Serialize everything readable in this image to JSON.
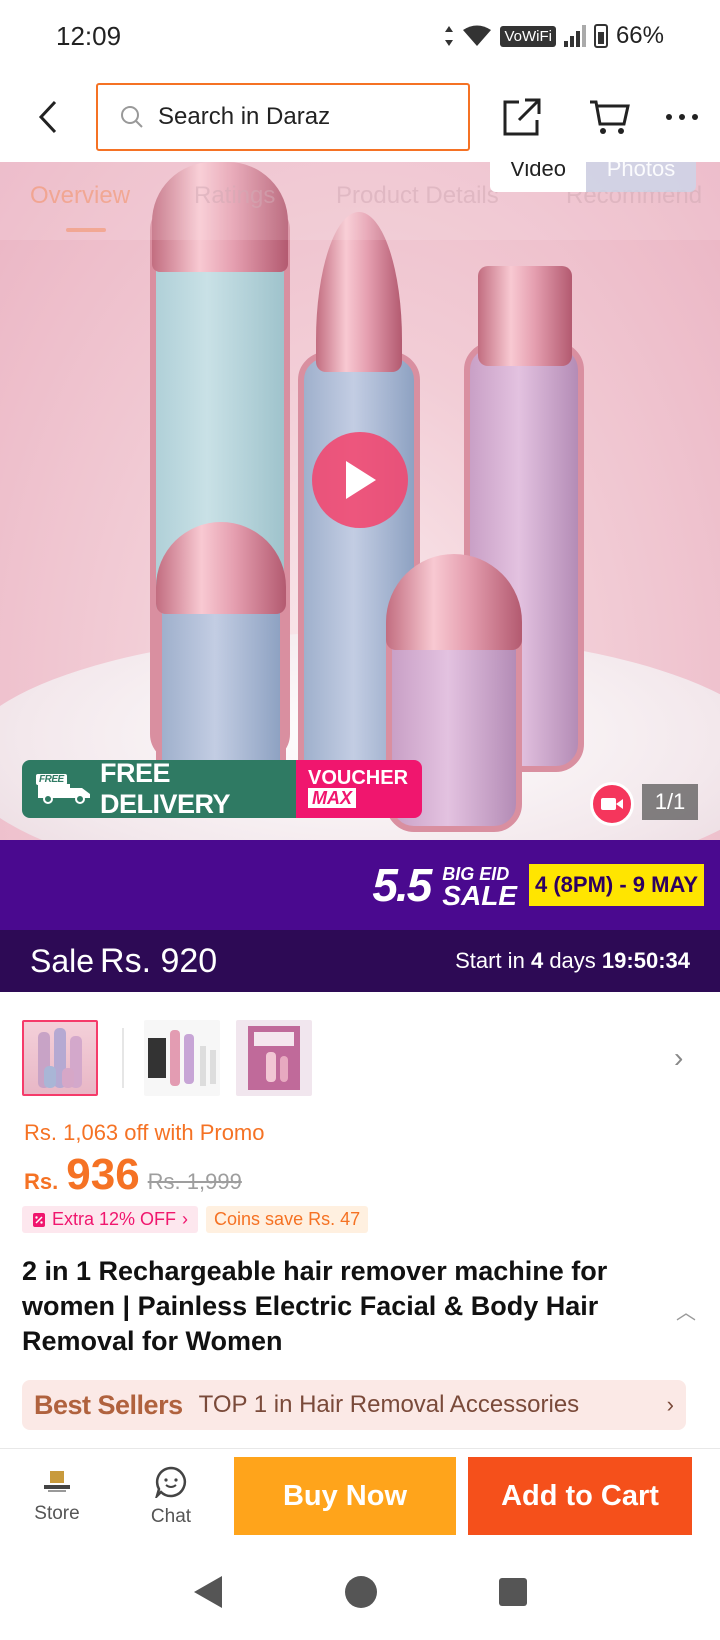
{
  "status": {
    "time": "12:09",
    "vowifi": "VoWiFi",
    "battery": "66%"
  },
  "header": {
    "search_placeholder": "Search in Daraz"
  },
  "hero": {
    "tabs": [
      "Overview",
      "Ratings",
      "Product Details",
      "Recommend"
    ],
    "media_video": "Video",
    "media_photos": "Photos",
    "counter": "1/1",
    "promo": {
      "free_tag": "FREE",
      "free_delivery": "FREE DELIVERY",
      "voucher": "VOUCHER",
      "voucher_max": "MAX"
    }
  },
  "sale_banner": {
    "number": "5.5",
    "big": "BIG EID",
    "sale": "SALE",
    "dates": "4 (8PM) - 9 MAY"
  },
  "sale_price": {
    "label": "Sale",
    "price": "Rs. 920",
    "start_in": "Start in",
    "days": "4",
    "days_label": "days",
    "countdown": "19:50:34"
  },
  "price": {
    "promo_off": "Rs. 1,063 off with Promo",
    "currency": "Rs.",
    "current": "936",
    "original": "Rs. 1,999",
    "extra_off": "Extra 12% OFF",
    "coins": "Coins save Rs. 47"
  },
  "product": {
    "title": "2 in 1 Rechargeable hair remover machine for women | Painless Electric Facial & Body Hair Removal for Women"
  },
  "bestseller": {
    "logo": "Best Sellers",
    "text": "TOP 1 in Hair Removal Accessories"
  },
  "bottom_bar": {
    "store": "Store",
    "chat": "Chat",
    "buy_now": "Buy Now",
    "add_to_cart": "Add to Cart"
  },
  "colors": {
    "accent": "#f57224",
    "sale_purple": "#4a098f",
    "buy_now": "#ffa41b",
    "add_to_cart": "#f5501b"
  }
}
